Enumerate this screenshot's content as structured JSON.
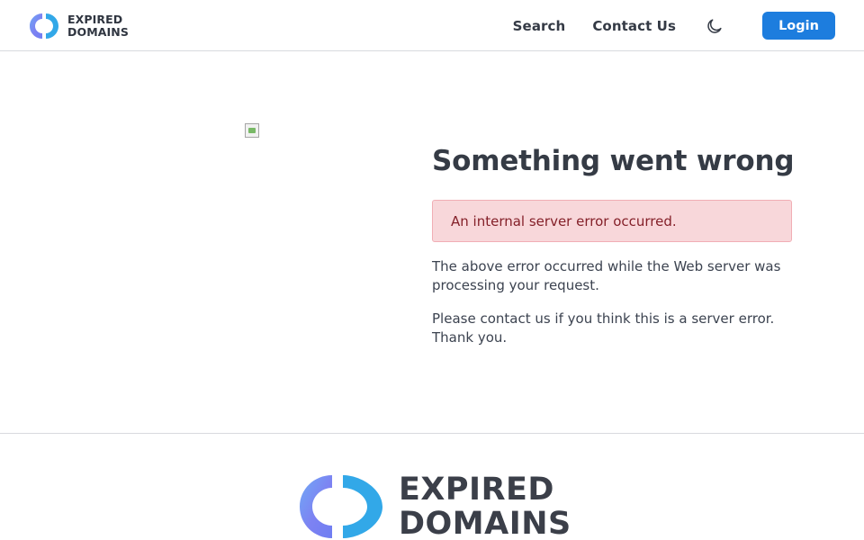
{
  "header": {
    "brand": {
      "line1": "EXPIRED",
      "line2": "DOMAINS"
    },
    "nav": {
      "search": "Search",
      "contact": "Contact Us",
      "login": "Login"
    },
    "icons": {
      "logo": "expired-domains-logo-icon",
      "theme": "moon-icon"
    }
  },
  "main": {
    "image": "broken-image-icon",
    "title": "Something went wrong",
    "alert": "An internal server error occurred.",
    "paragraphs": [
      "The above error occurred while the Web server was processing your request.",
      "Please contact us if you think this is a server error. Thank you."
    ]
  },
  "footer": {
    "brand": {
      "line1": "EXPIRED",
      "line2": "DOMAINS"
    }
  },
  "colors": {
    "accent": "#1d7dde",
    "logo_blue_start": "#3b9df0",
    "logo_purple_end": "#7f76f0",
    "alert_bg": "#f8d7da",
    "alert_text": "#842029"
  }
}
